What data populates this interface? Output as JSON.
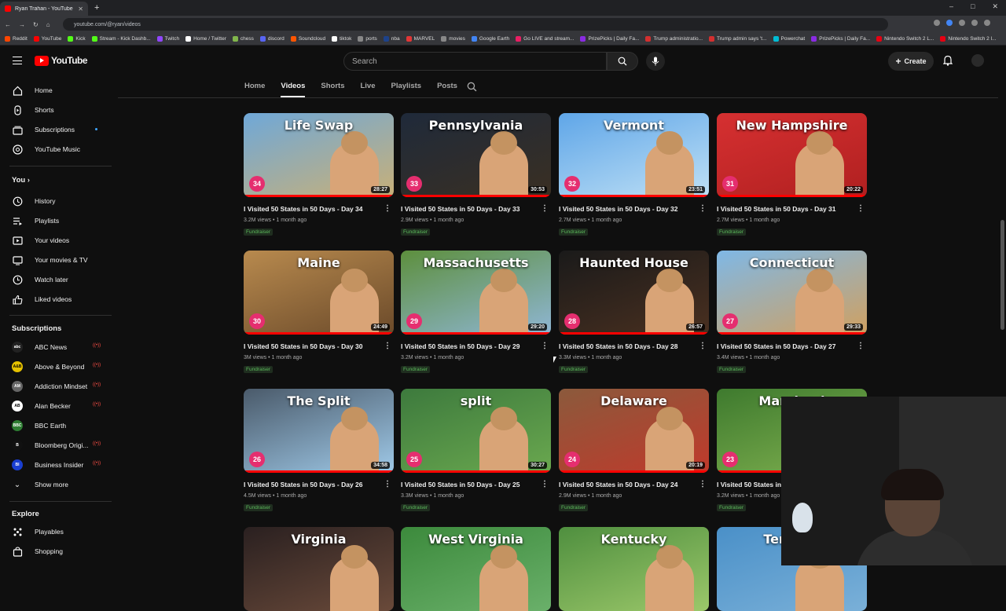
{
  "browser": {
    "tab_title": "Ryan Trahan - YouTube",
    "url": "youtube.com/@ryan/videos",
    "window_controls": [
      "–",
      "□",
      "✕"
    ],
    "bookmarks": [
      {
        "label": "Reddit",
        "color": "#ff4500"
      },
      {
        "label": "YouTube",
        "color": "#ff0000"
      },
      {
        "label": "Kick",
        "color": "#53fc18"
      },
      {
        "label": "Stream - Kick Dashb...",
        "color": "#53fc18"
      },
      {
        "label": "Twitch",
        "color": "#9146ff"
      },
      {
        "label": "Home / Twitter",
        "color": "#ffffff"
      },
      {
        "label": "chess",
        "color": "#81b64c"
      },
      {
        "label": "discord",
        "color": "#5865f2"
      },
      {
        "label": "Soundcloud",
        "color": "#ff5500"
      },
      {
        "label": "tiktok",
        "color": "#ffffff"
      },
      {
        "label": "ports",
        "color": "#888888"
      },
      {
        "label": "nba",
        "color": "#1d428a"
      },
      {
        "label": "MARVEL",
        "color": "#e23636"
      },
      {
        "label": "movies",
        "color": "#888888"
      },
      {
        "label": "Google Earth",
        "color": "#4285f4"
      },
      {
        "label": "Go LIVE and stream...",
        "color": "#e91e63"
      },
      {
        "label": "PrizePicks | Daily Fa...",
        "color": "#8a2be2"
      },
      {
        "label": "Trump administratio...",
        "color": "#d32f2f"
      },
      {
        "label": "Trump admin says 't...",
        "color": "#d32f2f"
      },
      {
        "label": "Powerchat",
        "color": "#00bcd4"
      },
      {
        "label": "PrizePicks | Daily Fa...",
        "color": "#8a2be2"
      },
      {
        "label": "Nintendo Switch 2 L...",
        "color": "#e60012"
      },
      {
        "label": "Nintendo Switch 2 l...",
        "color": "#e60012"
      }
    ]
  },
  "header": {
    "logo_text": "YouTube",
    "search_placeholder": "Search",
    "create_label": "Create"
  },
  "sidebar": {
    "main": [
      {
        "label": "Home",
        "icon": "home-icon"
      },
      {
        "label": "Shorts",
        "icon": "shorts-icon"
      },
      {
        "label": "Subscriptions",
        "icon": "subscriptions-icon"
      },
      {
        "label": "YouTube Music",
        "icon": "music-icon"
      }
    ],
    "you_heading": "You",
    "you": [
      {
        "label": "History",
        "icon": "history-icon"
      },
      {
        "label": "Playlists",
        "icon": "playlists-icon"
      },
      {
        "label": "Your videos",
        "icon": "your-videos-icon"
      },
      {
        "label": "Your movies & TV",
        "icon": "movies-icon"
      },
      {
        "label": "Watch later",
        "icon": "clock-icon"
      },
      {
        "label": "Liked videos",
        "icon": "thumbs-up-icon"
      }
    ],
    "subscriptions_heading": "Subscriptions",
    "subscriptions": [
      {
        "label": "ABC News",
        "color": "#222222",
        "abbr": "abc",
        "live": true
      },
      {
        "label": "Above & Beyond",
        "color": "#e5c100",
        "abbr": "A&B",
        "live": true
      },
      {
        "label": "Addiction Mindset",
        "color": "#666666",
        "abbr": "AM",
        "live": true
      },
      {
        "label": "Alan Becker",
        "color": "#ffffff",
        "abbr": "AB",
        "live": true
      },
      {
        "label": "BBC Earth",
        "color": "#2e7d32",
        "abbr": "BBC",
        "live": false
      },
      {
        "label": "Bloomberg Origi...",
        "color": "#111111",
        "abbr": "B",
        "live": true
      },
      {
        "label": "Business Insider",
        "color": "#1a3fd1",
        "abbr": "BI",
        "live": true
      }
    ],
    "show_more": "Show more",
    "explore_heading": "Explore",
    "explore": [
      {
        "label": "Playables",
        "icon": "playables-icon"
      },
      {
        "label": "Shopping",
        "icon": "shopping-icon"
      }
    ]
  },
  "channel_tabs": [
    "Home",
    "Videos",
    "Shorts",
    "Live",
    "Playlists",
    "Posts"
  ],
  "active_tab": "Videos",
  "videos": [
    {
      "title": "I Visited 50 States in 50 Days - Day 34",
      "views": "3.2M views",
      "age": "1 month ago",
      "badge": "Fundraiser",
      "duration": "28:27",
      "day": "34",
      "overlay": "Life Swap",
      "bg": "#6fa8d8",
      "bg2": "#c8b078"
    },
    {
      "title": "I Visited 50 States in 50 Days - Day 33",
      "views": "2.9M views",
      "age": "1 month ago",
      "badge": "Fundraiser",
      "duration": "30:53",
      "day": "33",
      "overlay": "Pennsylvania",
      "bg": "#1f2a3a",
      "bg2": "#3a2f22"
    },
    {
      "title": "I Visited 50 States in 50 Days - Day 32",
      "views": "2.7M views",
      "age": "1 month ago",
      "badge": "Fundraiser",
      "duration": "23:51",
      "day": "32",
      "overlay": "Vermont",
      "bg": "#5fa6e8",
      "bg2": "#bfe0f5"
    },
    {
      "title": "I Visited 50 States in 50 Days - Day 31",
      "views": "2.7M views",
      "age": "1 month ago",
      "badge": "Fundraiser",
      "duration": "20:22",
      "day": "31",
      "overlay": "New Hampshire",
      "bg": "#d63031",
      "bg2": "#b02020"
    },
    {
      "title": "I Visited 50 States in 50 Days - Day 30",
      "views": "3M views",
      "age": "1 month ago",
      "badge": "Fundraiser",
      "duration": "24:49",
      "day": "30",
      "overlay": "Maine",
      "bg": "#b88a4e",
      "bg2": "#6b4a2a"
    },
    {
      "title": "I Visited 50 States in 50 Days - Day 29",
      "views": "3.2M views",
      "age": "1 month ago",
      "badge": "Fundraiser",
      "duration": "29:20",
      "day": "29",
      "overlay": "Massachusetts",
      "bg": "#5d8f3d",
      "bg2": "#8fb6d4"
    },
    {
      "title": "I Visited 50 States in 50 Days - Day 28",
      "views": "3.3M views",
      "age": "1 month ago",
      "badge": "Fundraiser",
      "duration": "26:57",
      "day": "28",
      "overlay": "Haunted House",
      "bg": "#1a1a1a",
      "bg2": "#4a3020"
    },
    {
      "title": "I Visited 50 States in 50 Days - Day 27",
      "views": "3.4M views",
      "age": "1 month ago",
      "badge": "Fundraiser",
      "duration": "29:33",
      "day": "27",
      "overlay": "Connecticut",
      "bg": "#7fb8e6",
      "bg2": "#d0a060"
    },
    {
      "title": "I Visited 50 States in 50 Days - Day 26",
      "views": "4.5M views",
      "age": "1 month ago",
      "badge": "Fundraiser",
      "duration": "34:58",
      "day": "26",
      "overlay": "The Split",
      "bg": "#4a5a6a",
      "bg2": "#9fc9e8"
    },
    {
      "title": "I Visited 50 States in 50 Days - Day 25",
      "views": "3.3M views",
      "age": "1 month ago",
      "badge": "Fundraiser",
      "duration": "30:27",
      "day": "25",
      "overlay": "split",
      "bg": "#3d7a3d",
      "bg2": "#6aa84f"
    },
    {
      "title": "I Visited 50 States in 50 Days - Day 24",
      "views": "2.9M views",
      "age": "1 month ago",
      "badge": "Fundraiser",
      "duration": "20:19",
      "day": "24",
      "overlay": "Delaware",
      "bg": "#8b5a3c",
      "bg2": "#c0392b"
    },
    {
      "title": "I Visited 50 States in 50 Days - Day 23",
      "views": "3.2M views",
      "age": "1 month ago",
      "badge": "Fundraiser",
      "duration": "",
      "day": "23",
      "overlay": "Maryland",
      "bg": "#3e7a2e",
      "bg2": "#7fb04f"
    },
    {
      "title": "",
      "views": "",
      "age": "",
      "badge": "",
      "duration": "",
      "day": "",
      "overlay": "Virginia",
      "bg": "#2a2020",
      "bg2": "#6a4a3a"
    },
    {
      "title": "",
      "views": "",
      "age": "",
      "badge": "",
      "duration": "",
      "day": "",
      "overlay": "West Virginia",
      "bg": "#3c8a3c",
      "bg2": "#6ab06a"
    },
    {
      "title": "",
      "views": "",
      "age": "",
      "badge": "",
      "duration": "",
      "day": "",
      "overlay": "Kentucky",
      "bg": "#4f8f3f",
      "bg2": "#9cc86a"
    },
    {
      "title": "",
      "views": "",
      "age": "",
      "badge": "",
      "duration": "",
      "day": "",
      "overlay": "Tenness",
      "bg": "#4a90c8",
      "bg2": "#7ab0d8"
    }
  ]
}
